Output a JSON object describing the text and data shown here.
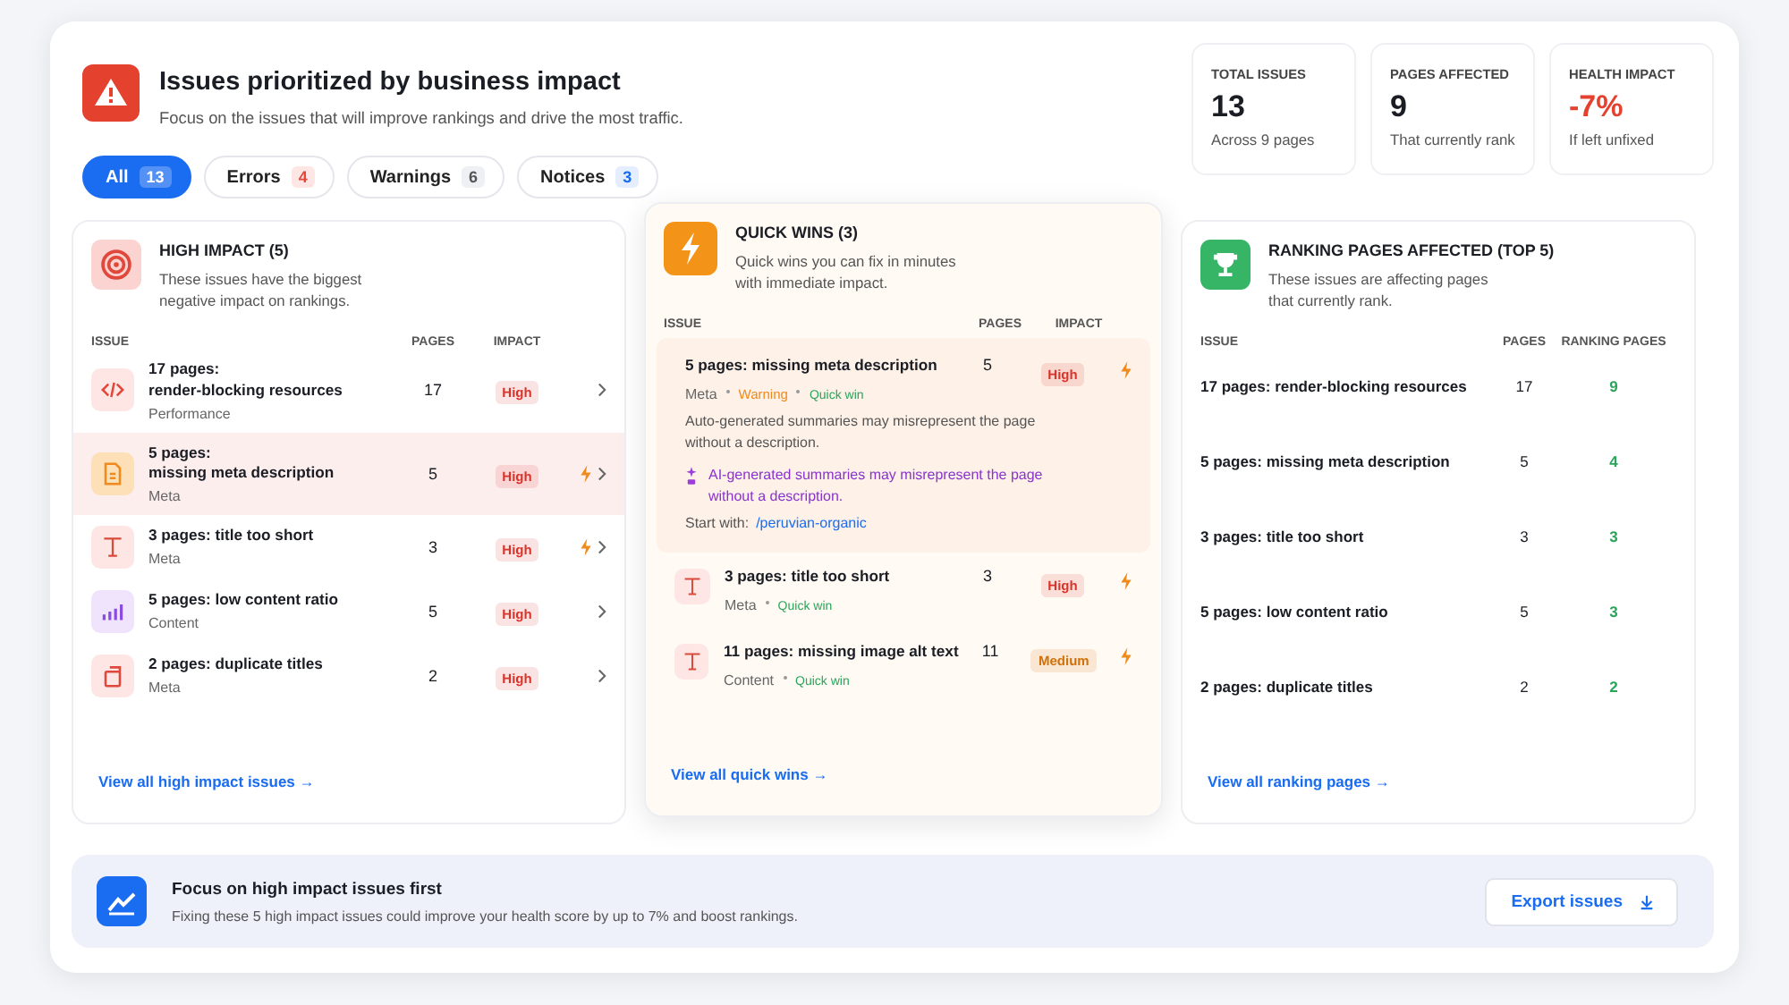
{
  "header": {
    "title": "Issues prioritized by business impact",
    "subtitle": "Focus on the issues that will improve rankings and drive the most traffic."
  },
  "filters": [
    {
      "label": "All",
      "count": "13",
      "kind": "all",
      "selected": true
    },
    {
      "label": "Errors",
      "count": "4",
      "kind": "error",
      "selected": false
    },
    {
      "label": "Warnings",
      "count": "6",
      "kind": "warning",
      "selected": false
    },
    {
      "label": "Notices",
      "count": "3",
      "kind": "notice",
      "selected": false
    }
  ],
  "stats": [
    {
      "label": "TOTAL ISSUES",
      "value": "13",
      "note": "Across 9 pages",
      "kind": "neutral"
    },
    {
      "label": "PAGES AFFECTED",
      "value": "9",
      "note": "That currently rank",
      "kind": "neutral"
    },
    {
      "label": "HEALTH IMPACT",
      "value": "-7%",
      "note": "If left unfixed",
      "kind": "negative"
    }
  ],
  "high_impact": {
    "title": "HIGH IMPACT (5)",
    "description": "These issues have the biggest negative impact on rankings.",
    "columns": [
      "ISSUE",
      "PAGES",
      "IMPACT"
    ],
    "rows": [
      {
        "kind": "code",
        "title": "17 pages:\nrender-blocking resources",
        "category": "Performance",
        "pages": "17",
        "impact": "High",
        "color": "#d9342b",
        "quick_win": false,
        "selected": false
      },
      {
        "kind": "document",
        "title": "5 pages:\nmissing meta description",
        "category": "Meta",
        "pages": "5",
        "impact": "High",
        "color": "#d9342b",
        "quick_win": true,
        "selected": true
      },
      {
        "kind": "text",
        "title": "3 pages: title too short",
        "category": "Meta",
        "pages": "3",
        "impact": "High",
        "color": "#d9342b",
        "quick_win": true,
        "selected": false
      },
      {
        "kind": "chart",
        "title": "5 pages: low content ratio",
        "category": "Content",
        "pages": "5",
        "impact": "High",
        "color": "#d9342b",
        "quick_win": false,
        "selected": false
      },
      {
        "kind": "copy",
        "title": "2 pages: duplicate titles",
        "category": "Meta",
        "pages": "2",
        "impact": "High",
        "color": "#d9342b",
        "quick_win": false,
        "selected": false
      }
    ],
    "link": "View all high impact issues →"
  },
  "quick_wins": {
    "title": "QUICK WINS (3)",
    "description": "Quick wins you can fix in minutes with immediate impact.",
    "columns": [
      "ISSUE",
      "PAGES",
      "IMPACT"
    ],
    "rows": [
      {
        "kind": "detail",
        "title": "5 pages: missing meta description",
        "category": "Meta",
        "status": "Warning",
        "tag": "Quick win",
        "pages": "5",
        "impact": "High",
        "color": "#d9342b",
        "expanded": true,
        "detail": "Auto-generated summaries may misrepresent the page without a description.",
        "ai_note": "AI-generated summaries may misrepresent the page without a description.",
        "start_label": "Start with:",
        "start_link": "/peruvian-organic"
      },
      {
        "kind": "text",
        "title": "3 pages: title too short",
        "category": "Meta",
        "tag": "Quick win",
        "pages": "3",
        "impact": "High",
        "color": "#d9342b",
        "expanded": false
      },
      {
        "kind": "text",
        "title": "11 pages: missing image alt text",
        "category": "Content",
        "tag": "Quick win",
        "pages": "11",
        "impact": "Medium",
        "color": "#d0700a",
        "expanded": false
      }
    ],
    "link": "View all quick wins →"
  },
  "ranking": {
    "title": "RANKING PAGES AFFECTED (TOP 5)",
    "description": "These issues are affecting pages that currently rank.",
    "columns": [
      "ISSUE",
      "PAGES",
      "RANKING PAGES"
    ],
    "rows": [
      {
        "title": "17 pages: render-blocking resources",
        "pages": "17",
        "ranking_pages": "9"
      },
      {
        "title": "5 pages: missing meta description",
        "pages": "5",
        "ranking_pages": "4"
      },
      {
        "title": "3 pages: title too short",
        "pages": "3",
        "ranking_pages": "3"
      },
      {
        "title": "5 pages: low content ratio",
        "pages": "5",
        "ranking_pages": "3"
      },
      {
        "title": "2 pages: duplicate titles",
        "pages": "2",
        "ranking_pages": "2"
      }
    ],
    "link": "View all ranking pages →"
  },
  "banner": {
    "title": "Focus on high impact issues first",
    "text": "Fixing these 5 high impact issues could improve your health score by up to 7% and boost rankings.",
    "button": "Export issues"
  }
}
